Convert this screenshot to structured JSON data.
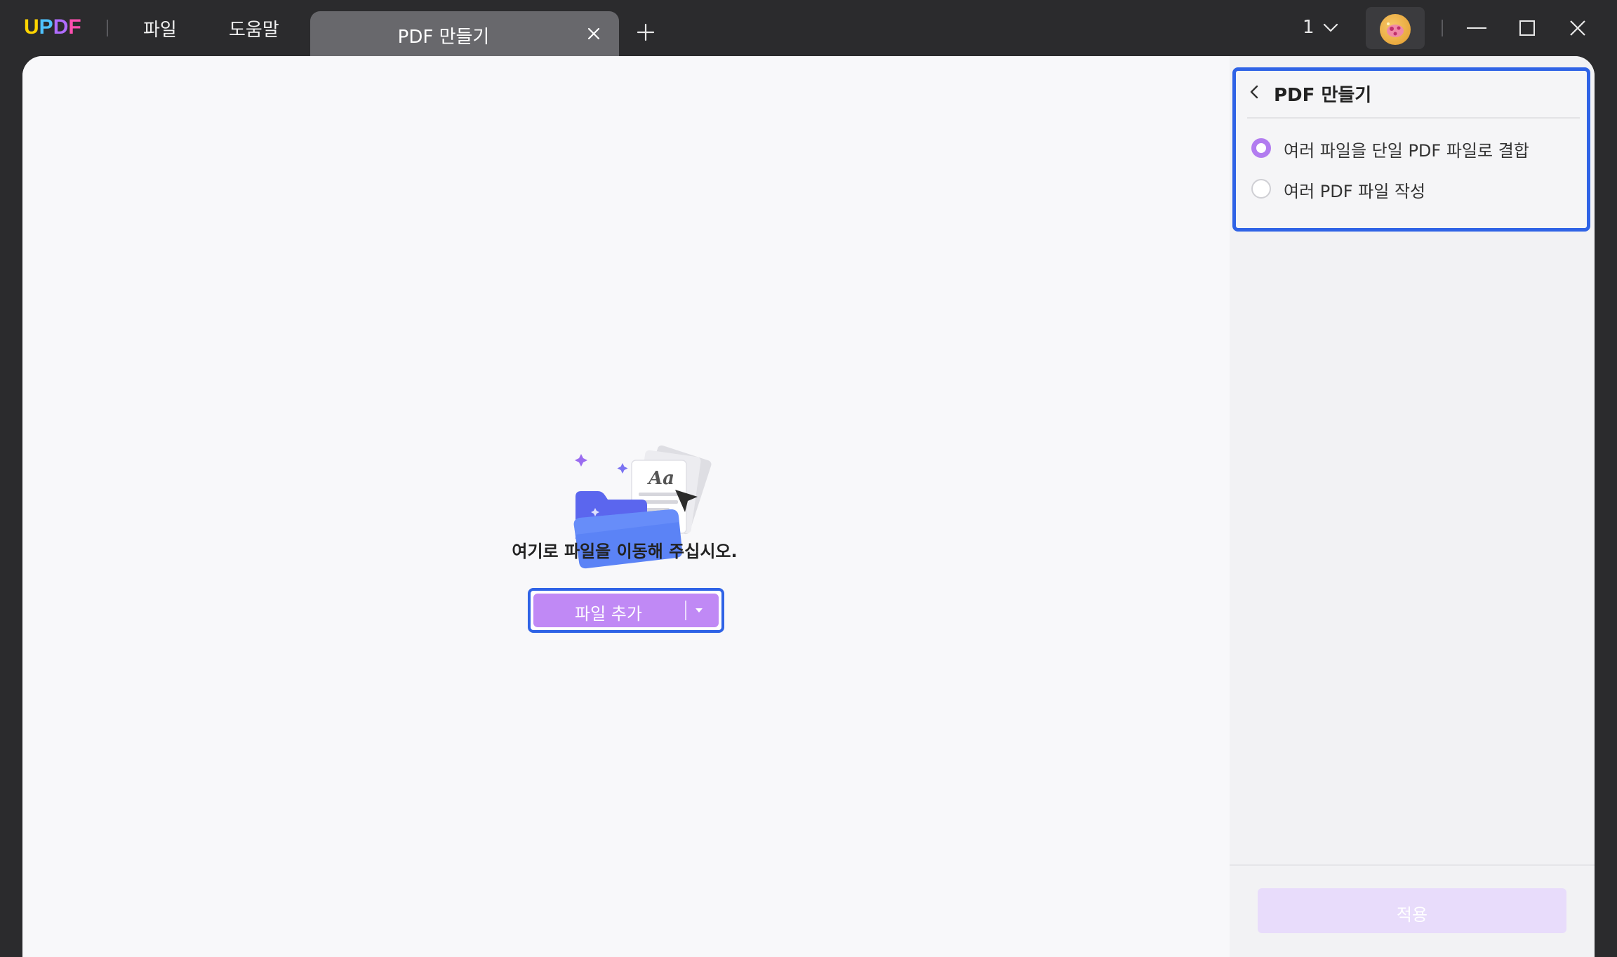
{
  "app": {
    "logo_letters": [
      "U",
      "P",
      "D",
      "F"
    ],
    "logo_colors": [
      "#ffd400",
      "#4fc3ff",
      "#b06cff",
      "#ff4fb0"
    ]
  },
  "menu": {
    "file": "파일",
    "help": "도움말"
  },
  "tab": {
    "title": "PDF 만들기",
    "close_icon": "close-icon"
  },
  "titlebar_right": {
    "page_count": "1"
  },
  "dropzone": {
    "message": "여기로 파일을 이동해 주십시오.",
    "add_file_label": "파일 추가",
    "illustration_text": "Aa"
  },
  "side_panel": {
    "title": "PDF 만들기",
    "options": [
      {
        "label": "여러 파일을 단일 PDF 파일로 결합",
        "checked": true
      },
      {
        "label": "여러 PDF 파일 작성",
        "checked": false
      }
    ],
    "apply_label": "적용"
  },
  "colors": {
    "accent": "#c089f5",
    "highlight": "#2f63e6"
  }
}
